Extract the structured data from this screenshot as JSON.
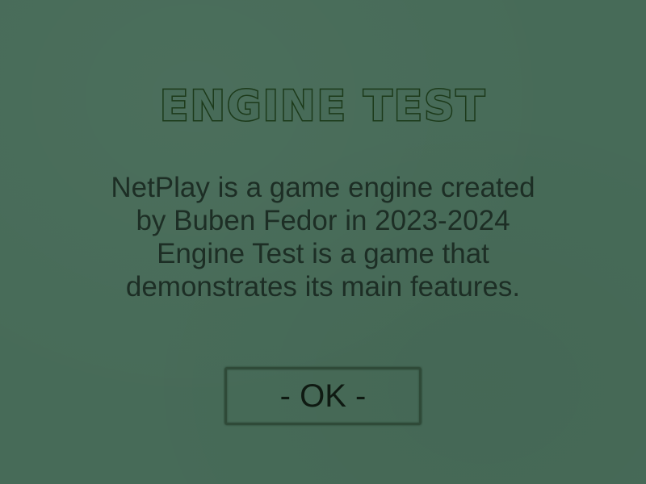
{
  "dialog": {
    "title": "Engine Test",
    "description_lines": [
      "NetPlay is a game engine created",
      "by Buben Fedor in 2023-2024",
      "Engine Test is a game that",
      "demonstrates its main features."
    ],
    "ok_label": "- OK -"
  },
  "colors": {
    "background": "#476b58",
    "title_outline": "#1c3a1a",
    "text": "#1d2e25",
    "button_border": "#2f4a38"
  }
}
